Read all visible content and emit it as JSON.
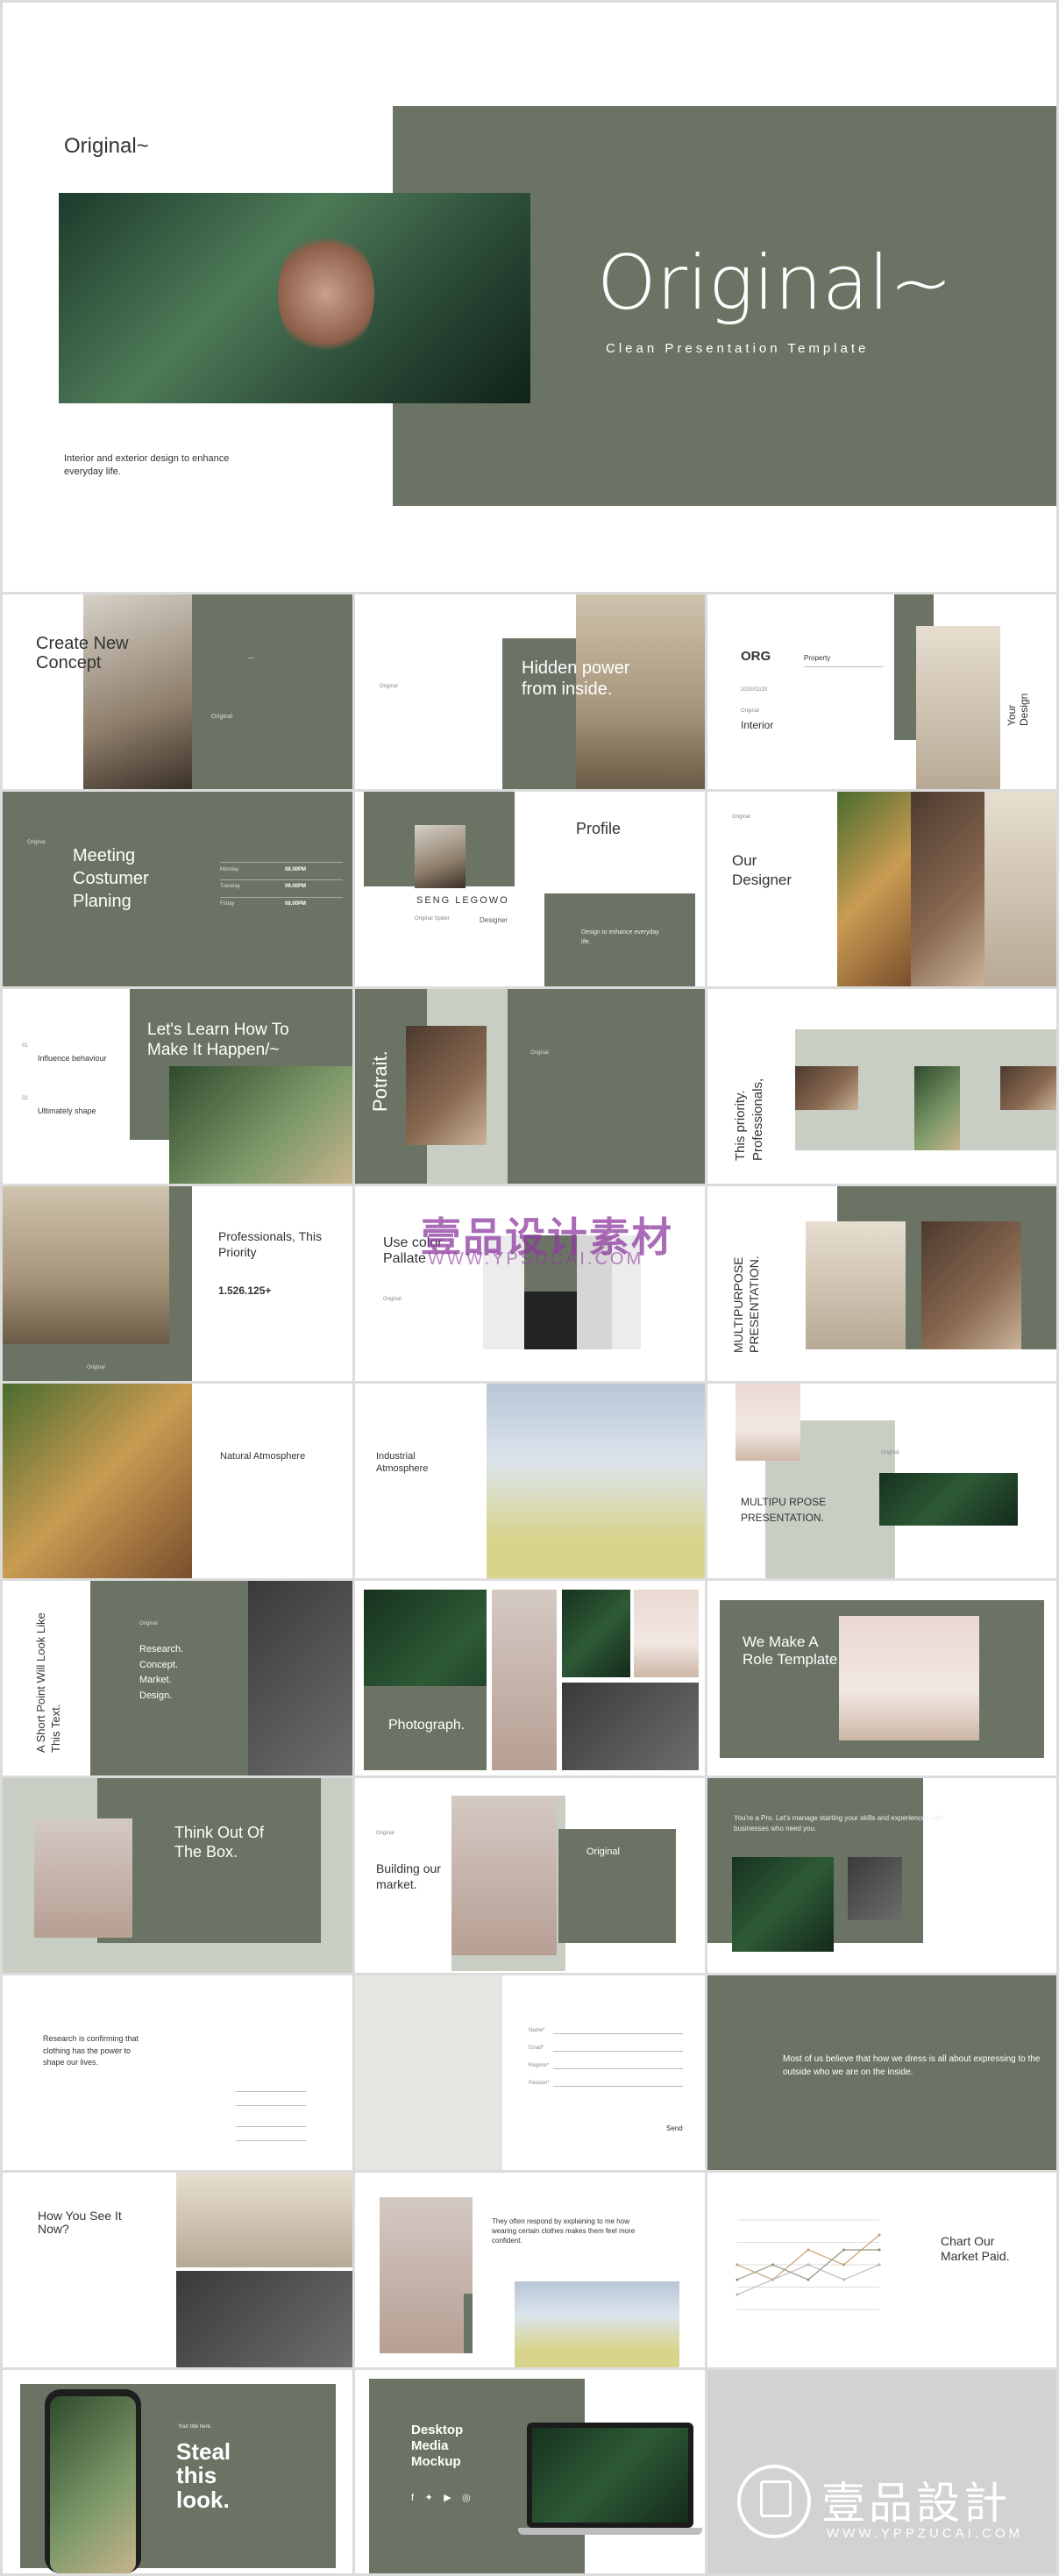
{
  "hero": {
    "brand": "Original~",
    "title": "Original~",
    "subtitle": "Clean Presentation Template",
    "caption": "Interior and exterior design to enhance everyday life."
  },
  "slides": {
    "s1": {
      "title": "Create New Concept",
      "side": "Original"
    },
    "s2": {
      "title": "Hidden power from inside.",
      "label": "Original"
    },
    "s3": {
      "org": "ORG",
      "property": "Property",
      "date": "2020/02/20",
      "label": "Original",
      "interior": "Interior",
      "vertical": "Your Design"
    },
    "s4": {
      "label": "Original",
      "title": "Meeting Costumer Planing",
      "rows": [
        {
          "day": "Monday",
          "time": "08.00PM"
        },
        {
          "day": "Tuesday",
          "time": "09.00PM"
        },
        {
          "day": "Friday",
          "time": "08.00PM"
        }
      ]
    },
    "s5": {
      "title": "Profile",
      "name": "SENG LEGOWO",
      "role": "Designer",
      "left_label": "Original Spider",
      "quote": "Design to enhance everyday life."
    },
    "s6": {
      "label": "Original",
      "title": "Our Designer"
    },
    "s7": {
      "title": "Let's Learn How To Make It Happen/~",
      "n1": "01",
      "i1": "Influence behaviour",
      "n2": "02",
      "i2": "Ultimately shape"
    },
    "s8": {
      "vertical": "Potrait.",
      "label": "Original"
    },
    "s9": {
      "vertical": "This priority. Professionals,"
    },
    "s10": {
      "title": "Professionals, This Priority",
      "number": "1.526.125+",
      "caption": "Original"
    },
    "s11": {
      "title": "Use color Pallate",
      "label": "Original"
    },
    "s12": {
      "vertical": "MULTIPURPOSE PRESENTATION."
    },
    "s13": {
      "title": "Natural Atmosphere"
    },
    "s14": {
      "title": "Industrial Atmosphere"
    },
    "s15": {
      "title": "MULTIPU RPOSE PRESENTATION.",
      "label": "Original"
    },
    "s16": {
      "vertical": "A Short Point Will Look Like This Text.",
      "label": "Original",
      "list": "Research. Concept. Market. Design."
    },
    "s17": {
      "title": "Photograph."
    },
    "s18": {
      "title": "We Make A Role Template"
    },
    "s19": {
      "title": "Think Out Of The Box."
    },
    "s20": {
      "label": "Original",
      "title": "Building our market.",
      "label2": "Original"
    },
    "s21": {
      "quote": "You're a Pro. Let's manage starting your skills and experiences with businesses who need you."
    },
    "s22": {
      "text": "Research is confirming that clothing has the power to shape our lives."
    },
    "s23": {
      "fields": [
        "Name*",
        "Email*",
        "Regime*",
        "Passion*"
      ],
      "send": "Send"
    },
    "s24": {
      "text": "Most of us believe that how we dress is all about expressing to the outside who we are on the inside."
    },
    "s25": {
      "title": "How You See It Now?"
    },
    "s26": {
      "quote": "They often respond by explaining to me how wearing certain clothes makes them feel more confident."
    },
    "s27": {
      "title": "Chart Our Market Paid."
    },
    "s28": {
      "small": "Your title here.",
      "title": "Steal this look."
    },
    "s29": {
      "title": "Desktop Media Mockup"
    }
  },
  "brand_logo": {
    "cn": "壹品設計",
    "url": "WWW.YPPZUCAI.COM"
  },
  "watermark": {
    "cn": "壹品设计素材",
    "url": "WWW.YPSUCAI.COM"
  },
  "colors": {
    "olive": "#6b7464",
    "light_olive": "#c9cec4",
    "bg": "#f5f5f5"
  },
  "chart_data": {
    "type": "line",
    "title": "",
    "series": [
      {
        "values": [
          3,
          2,
          4,
          3,
          5
        ]
      },
      {
        "values": [
          2,
          3,
          2,
          4,
          4
        ]
      },
      {
        "values": [
          1,
          2,
          3,
          2,
          3
        ]
      }
    ],
    "grid": true
  }
}
